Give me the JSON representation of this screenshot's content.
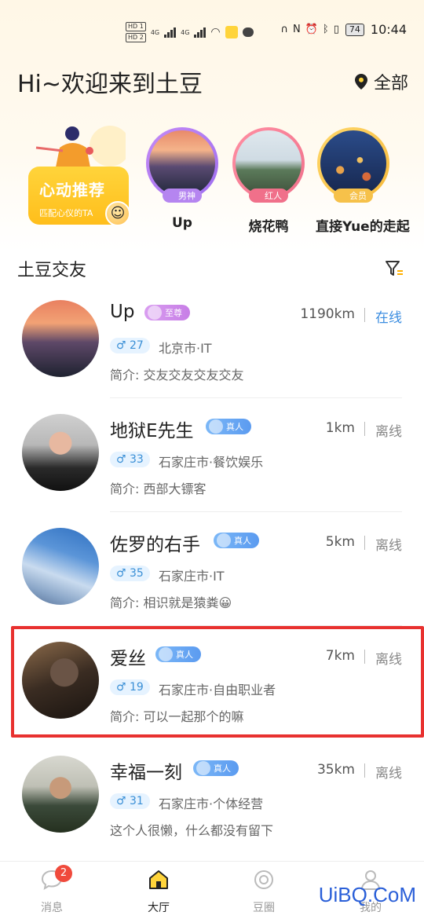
{
  "status_bar": {
    "sim1": "HD 1",
    "sim2": "HD 2",
    "net1": "4G",
    "net2": "4G",
    "battery": "74",
    "time": "10:44"
  },
  "header": {
    "greeting": "Hi~欢迎来到土豆",
    "location": "全部"
  },
  "recommend": {
    "title": "心动推荐",
    "subtitle": "匹配心仪的TA"
  },
  "stories": [
    {
      "name": "Up",
      "badge": "男神",
      "color": "#b585f0"
    },
    {
      "name": "烧花鸭",
      "badge": "红人",
      "color": "#f0708a"
    },
    {
      "name": "直接Yue的走起",
      "badge": "会员",
      "color": "#f6c14a"
    }
  ],
  "section": {
    "title": "土豆交友"
  },
  "users": [
    {
      "name": "Up",
      "tag": "至尊",
      "distance": "1190km",
      "status": "在线",
      "online": true,
      "age": "♂ 27",
      "place": "北京市·IT",
      "intro": "简介:  交友交友交友交友"
    },
    {
      "name": "地狱E先生",
      "tag": "真人",
      "distance": "1km",
      "status": "离线",
      "online": false,
      "age": "♂ 33",
      "place": "石家庄市·餐饮娱乐",
      "intro": "简介:  西部大镖客"
    },
    {
      "name": "佐罗的右手",
      "tag": "真人",
      "distance": "5km",
      "status": "离线",
      "online": false,
      "age": "♂ 35",
      "place": "石家庄市·IT",
      "intro": "简介:  相识就是猿粪😀"
    },
    {
      "name": "爱丝",
      "tag": "真人",
      "distance": "7km",
      "status": "离线",
      "online": false,
      "age": "♂ 19",
      "place": "石家庄市·自由职业者",
      "intro": "简介:  可以一起那个的嘛"
    },
    {
      "name": "幸福一刻",
      "tag": "真人",
      "distance": "35km",
      "status": "离线",
      "online": false,
      "age": "♂ 31",
      "place": "石家庄市·个体经营",
      "intro": "这个人很懒，什么都没有留下"
    }
  ],
  "nav": {
    "messages": "消息",
    "messages_count": "2",
    "hall": "大厅",
    "circle": "豆圈",
    "me": "我的"
  },
  "watermark": "UiBQ.CoM",
  "colors": {
    "accent": "#ffc21a",
    "online": "#3b8de0",
    "highlight": "#e8312f",
    "tag_zhizun": "#c77ee6",
    "tag_zhenren": "#5b9bf0"
  }
}
